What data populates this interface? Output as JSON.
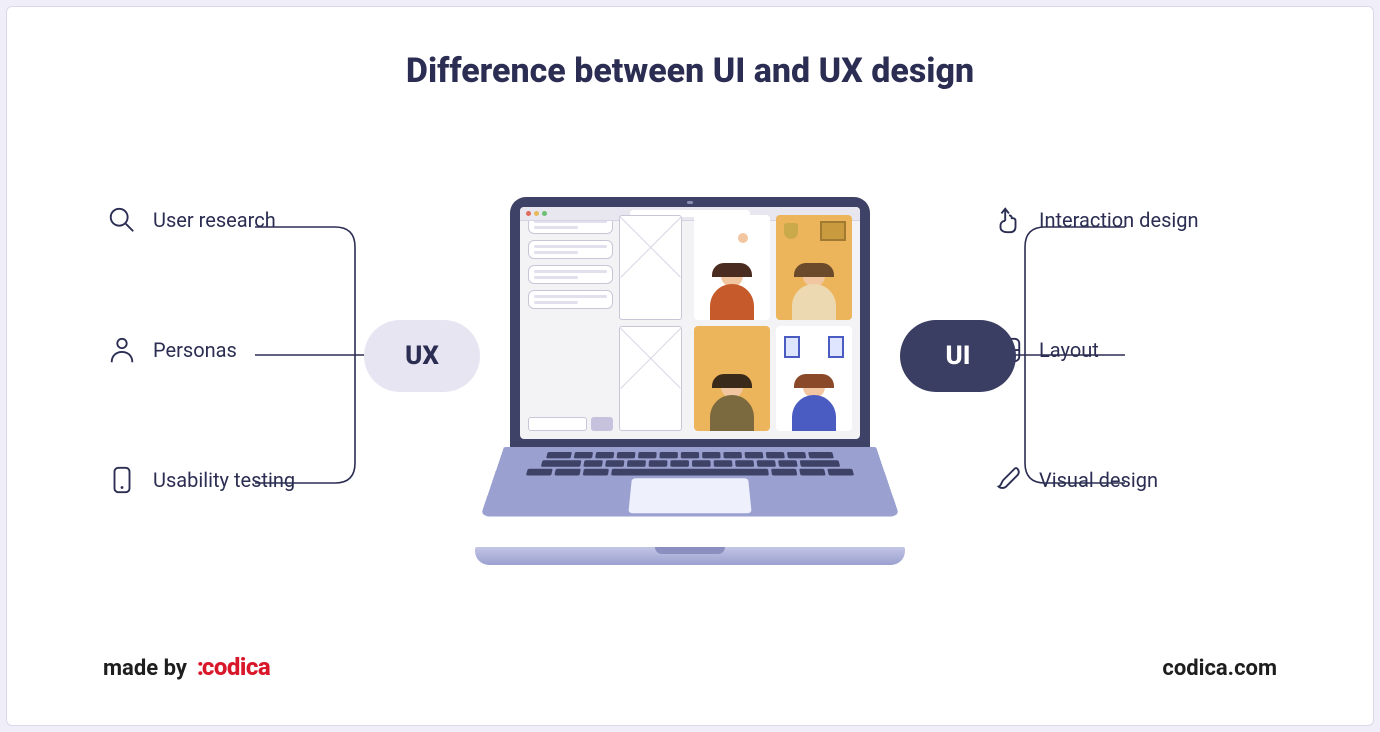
{
  "title": "Difference between UI and UX design",
  "ux": {
    "pill": "UX",
    "items": [
      {
        "icon": "search",
        "label": "User research"
      },
      {
        "icon": "person",
        "label": "Personas"
      },
      {
        "icon": "mobile",
        "label": "Usability testing"
      }
    ]
  },
  "ui": {
    "pill": "UI",
    "items": [
      {
        "icon": "pointer",
        "label": "Interaction design"
      },
      {
        "icon": "grid",
        "label": "Layout"
      },
      {
        "icon": "brush",
        "label": "Visual design"
      }
    ]
  },
  "footer": {
    "made_by": "made by",
    "brand": ":codica",
    "url": "codica.com"
  },
  "colors": {
    "text": "#2b2e52",
    "ux_pill_bg": "#e7e5f1",
    "ui_pill_bg": "#3a3e62",
    "brand_red": "#d9172b"
  }
}
